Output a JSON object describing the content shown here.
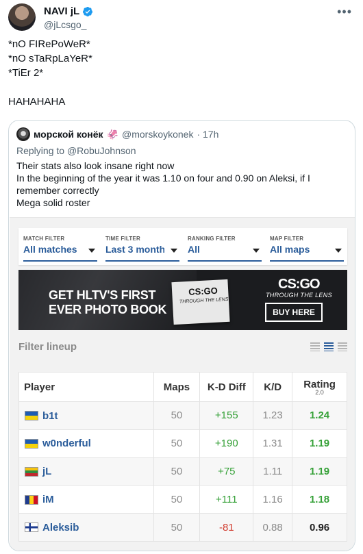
{
  "tweet": {
    "author_name": "NAVI jL",
    "author_handle": "@jLcsgo_",
    "more_icon": "•••",
    "lines": [
      "*nO FIRePoWeR*",
      "*nO sTaRpLaYeR*",
      "*TiEr 2*",
      "",
      "HAHAHAHA"
    ]
  },
  "quote": {
    "author_name": "морской конёк",
    "author_emoji": "🦑",
    "author_handle": "@morskoykonek",
    "time": "· 17h",
    "reply_prefix": "Replying to ",
    "reply_to": "@RobuJohnson",
    "body": [
      "Their stats also look insane right now",
      "In the beginning of the year it was 1.10 on four and 0.90 on Aleksi, if I",
      "remember correctly",
      "Mega solid roster"
    ]
  },
  "hltv": {
    "filters": [
      {
        "label": "MATCH FILTER",
        "value": "All matches"
      },
      {
        "label": "TIME FILTER",
        "value": "Last 3 months"
      },
      {
        "label": "RANKING FILTER",
        "value": "All"
      },
      {
        "label": "MAP FILTER",
        "value": "All maps"
      }
    ],
    "banner": {
      "line1": "GET HLTV'S FIRST",
      "line2": "EVER PHOTO BOOK",
      "book_title": "CS:GO",
      "book_sub": "THROUGH THE LENS",
      "brand": "CS:GO",
      "brand_sub": "THROUGH THE LENS",
      "cta": "BUY HERE"
    },
    "filter_lineup_title": "Filter lineup",
    "table": {
      "headers": [
        "Player",
        "Maps",
        "K-D Diff",
        "K/D",
        "Rating"
      ],
      "rating_version": "2.0",
      "rows": [
        {
          "player": "b1t",
          "flag": "ua",
          "maps": "50",
          "kd_diff": "+155",
          "kd": "1.23",
          "rating": "1.24"
        },
        {
          "player": "w0nderful",
          "flag": "ua",
          "maps": "50",
          "kd_diff": "+190",
          "kd": "1.31",
          "rating": "1.19"
        },
        {
          "player": "jL",
          "flag": "lt",
          "maps": "50",
          "kd_diff": "+75",
          "kd": "1.11",
          "rating": "1.19"
        },
        {
          "player": "iM",
          "flag": "ro",
          "maps": "50",
          "kd_diff": "+111",
          "kd": "1.16",
          "rating": "1.18"
        },
        {
          "player": "Aleksib",
          "flag": "fi",
          "maps": "50",
          "kd_diff": "-81",
          "kd": "0.88",
          "rating": "0.96"
        }
      ]
    }
  },
  "colors": {
    "verified": "#1d9bf0",
    "hltv_blue": "#2a5c9a",
    "positive": "#36a138",
    "negative": "#d13c2f"
  }
}
